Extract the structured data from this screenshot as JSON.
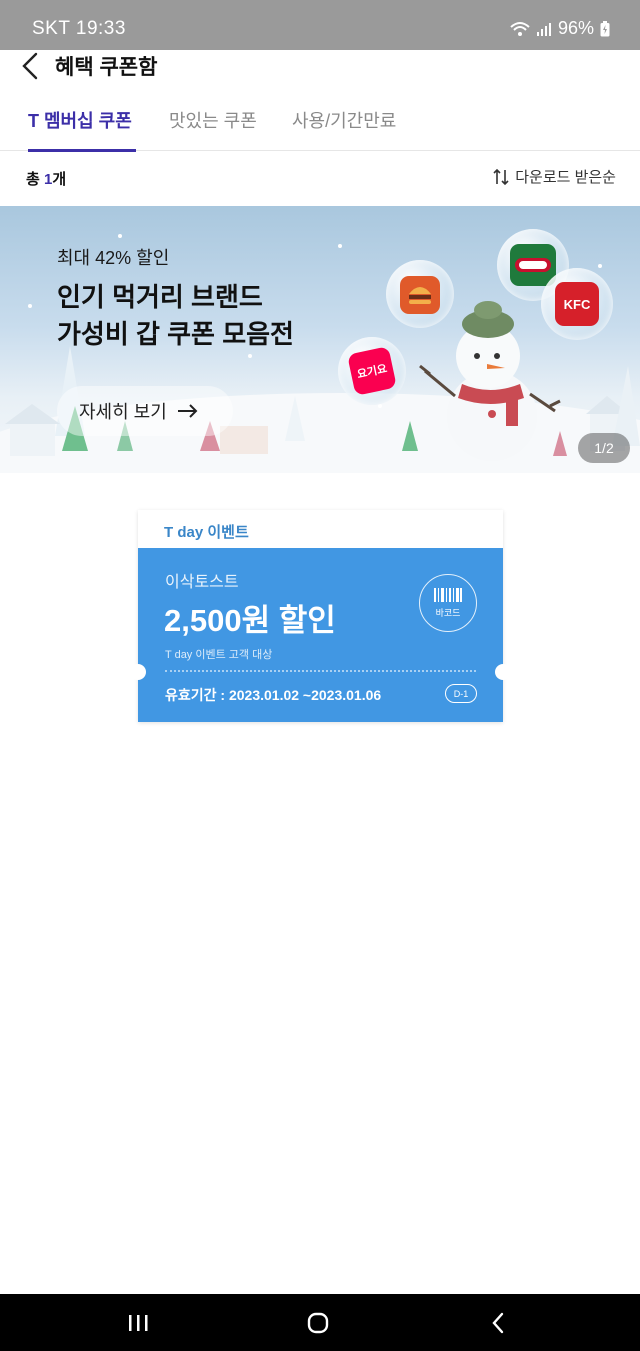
{
  "status_bar": {
    "carrier_time": "SKT 19:33",
    "battery": "96%"
  },
  "header": {
    "title": "혜택 쿠폰함"
  },
  "tabs": [
    {
      "label": "T 멤버십 쿠폰",
      "active": true
    },
    {
      "label": "맛있는 쿠폰",
      "active": false
    },
    {
      "label": "사용/기간만료",
      "active": false
    }
  ],
  "list": {
    "count_prefix": "총 ",
    "count_value": "1",
    "count_suffix": "개",
    "sort_label": "다운로드 받은순"
  },
  "banner": {
    "subtitle": "최대 42% 할인",
    "title_line1": "인기 먹거리 브랜드",
    "title_line2": "가성비 갑 쿠폰 모음전",
    "cta": "자세히 보기",
    "pager": "1/2",
    "logo_yogiyo": "요기요",
    "logo_kfc": "KFC"
  },
  "coupon": {
    "event_label": "T day 이벤트",
    "brand": "이삭토스트",
    "discount": "2,500원 할인",
    "target": "T day 이벤트 고객 대상",
    "validity": "유효기간 : 2023.01.02 ~2023.01.06",
    "dday": "D-1",
    "barcode_label": "바코드",
    "colors": {
      "body": "#4197e3",
      "label": "#3a86c8"
    }
  },
  "colors": {
    "accent": "#3c2fa8"
  }
}
